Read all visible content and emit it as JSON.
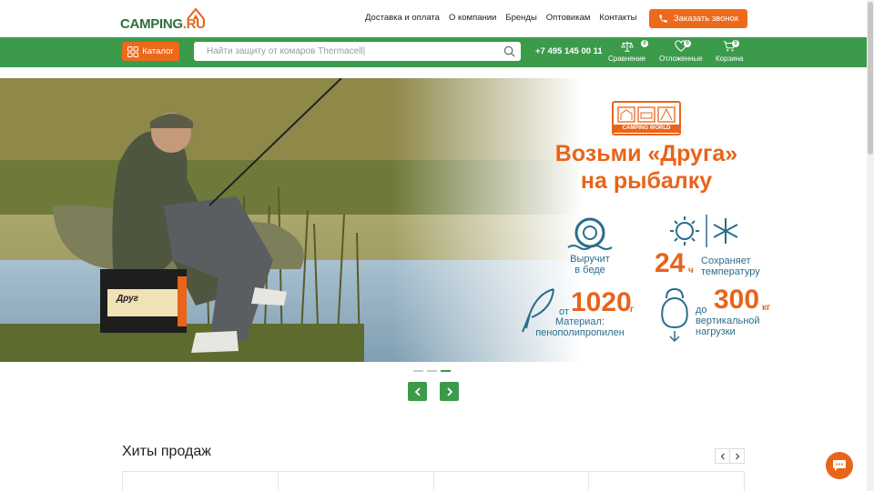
{
  "header": {
    "logo_text": "CAMPING",
    "logo_suffix": ".RU",
    "nav": [
      "Доставка и оплата",
      "О компании",
      "Бренды",
      "Оптовикам",
      "Контакты"
    ],
    "callback_label": "Заказать звонок"
  },
  "toolbar": {
    "catalog_label": "Каталог",
    "search_placeholder": "Найти защиту от комаров Thermacell|",
    "phone": "+7 495 145 00 11",
    "icons": [
      {
        "label": "Сравнение",
        "count": "0",
        "icon": "scales-icon"
      },
      {
        "label": "Отложенные",
        "count": "0",
        "icon": "heart-icon"
      },
      {
        "label": "Корзина",
        "count": "0",
        "icon": "cart-icon"
      }
    ]
  },
  "banner": {
    "brand_logo": "CAMPING WORLD",
    "headline_line1": "Возьми «Друга»",
    "headline_line2": "на рыбалку",
    "feature_rescue": "Выручит\nв беде",
    "feature_temp_num": "24",
    "feature_temp_unit": "ч",
    "feature_temp_text": "Сохраняет\nтемпературу",
    "feature_weight_prefix": "от",
    "feature_weight_num": "1020",
    "feature_weight_unit": "г",
    "feature_weight_text": "Материал:\nпенополипропилен",
    "feature_load_prefix": "до",
    "feature_load_num": "300",
    "feature_load_unit": "кг",
    "feature_load_text": "вертикальной\nнагрузки",
    "box_label": "Друг"
  },
  "slider": {
    "total": 3,
    "active": 3
  },
  "hits": {
    "title": "Хиты продаж"
  },
  "colors": {
    "green": "#3c9a4b",
    "orange": "#ee6a1b",
    "blue_text": "#2a6d8c"
  }
}
